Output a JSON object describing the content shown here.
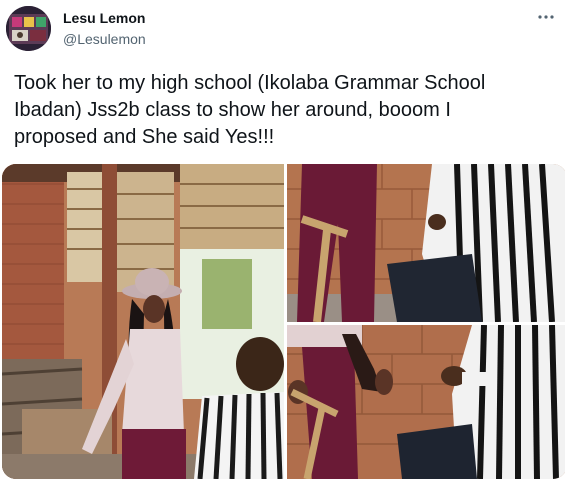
{
  "tweet": {
    "author": {
      "display_name": "Lesu Lemon",
      "handle": "@Lesulemon"
    },
    "text": "Took her to my high school (Ikolaba Grammar School\nIbadan) Jss2b class to show her around, booom I\nproposed and She said Yes!!!",
    "more_icon": "more-horizontal-icon",
    "photos": [
      {
        "label": "classroom-proposal-photo"
      },
      {
        "label": "kneeling-closeup-photo"
      },
      {
        "label": "ring-closeup-photo"
      }
    ]
  },
  "colors": {
    "text_primary": "#0f1419",
    "text_secondary": "#536471"
  }
}
